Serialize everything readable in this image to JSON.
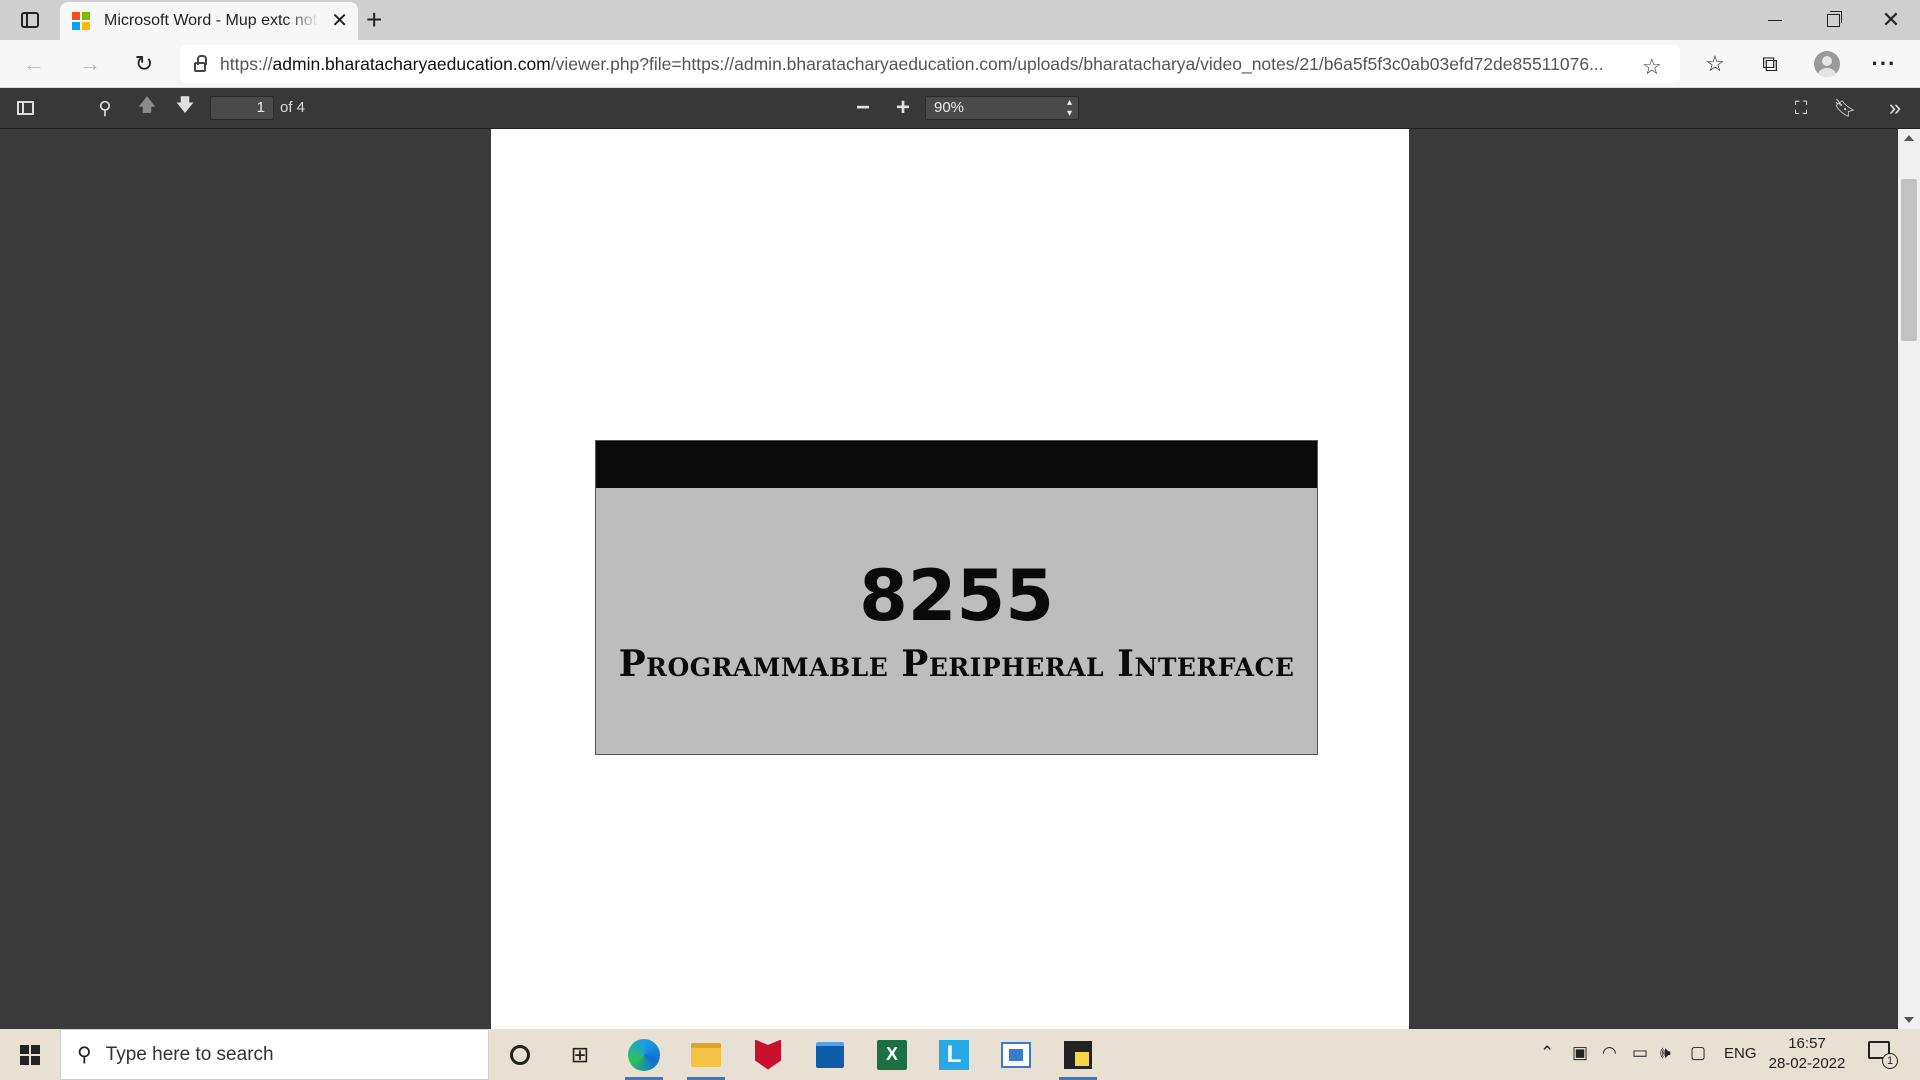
{
  "browser": {
    "tab_title": "Microsoft Word - Mup extc notes",
    "url_scheme": "https://",
    "url_host": "admin.bharatacharyaeducation.com",
    "url_rest": "/viewer.php?file=https://admin.bharatacharyaeducation.com/uploads/bharatacharya/video_notes/21/b6a5f5f3c0ab03efd72de85511076..."
  },
  "pdf_toolbar": {
    "page_number": "1",
    "page_count": "of 4",
    "zoom": "90%"
  },
  "document": {
    "chip_number": "8255",
    "subtitle": "Programmable Peripheral Interface",
    "band_color": "#0b0b0b",
    "box_color": "#bdbdbd"
  },
  "taskbar": {
    "search_placeholder": "Type here to search",
    "language": "ENG",
    "time": "16:57",
    "date": "28-02-2022",
    "notification_count": "1"
  },
  "icons": {
    "microsoft-logo": [
      "#f25022",
      "#7fba00",
      "#00a4ef",
      "#ffb900"
    ]
  }
}
